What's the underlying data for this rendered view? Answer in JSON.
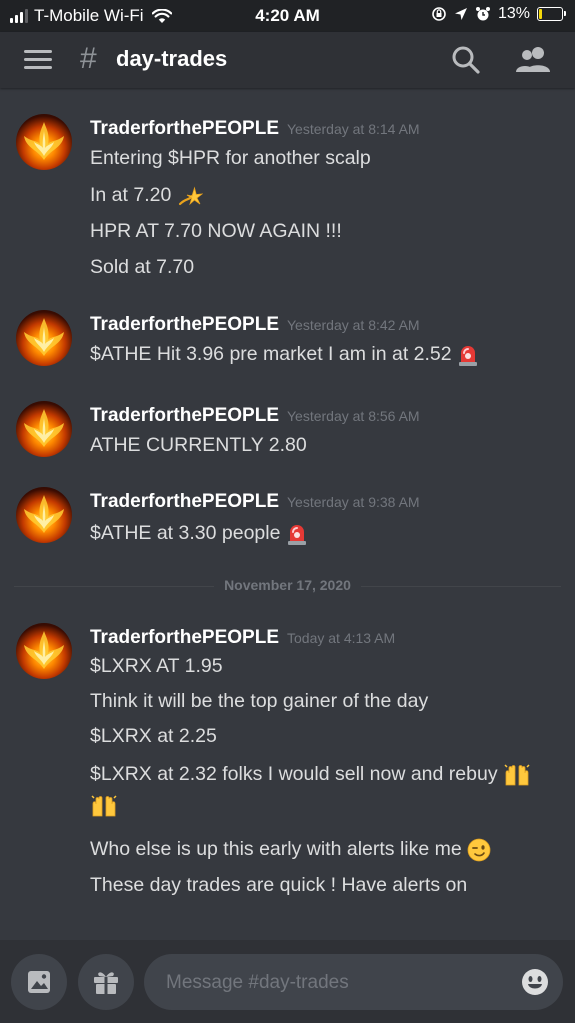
{
  "status_bar": {
    "carrier": "T-Mobile Wi-Fi",
    "time": "4:20 AM",
    "battery": "13%",
    "battery_level": 0.13
  },
  "header": {
    "hash": "#",
    "channel": "day-trades"
  },
  "messages": [
    {
      "author": "TraderforthePEOPLE",
      "timestamp": "Yesterday at 8:14 AM",
      "lines": [
        "Entering $HPR for another scalp",
        "In at 7.20",
        "HPR AT 7.70 NOW AGAIN !!!",
        "Sold at 7.70"
      ]
    },
    {
      "author": "TraderforthePEOPLE",
      "timestamp": "Yesterday at 8:42 AM",
      "lines": [
        "$ATHE Hit 3.96 pre market I am in at 2.52"
      ]
    },
    {
      "author": "TraderforthePEOPLE",
      "timestamp": "Yesterday at 8:56 AM",
      "lines": [
        "ATHE CURRENTLY 2.80"
      ]
    },
    {
      "author": "TraderforthePEOPLE",
      "timestamp": "Yesterday at 9:38 AM",
      "lines": [
        "$ATHE at 3.30 people"
      ]
    },
    {
      "author": "TraderforthePEOPLE",
      "timestamp": "Today at 4:13 AM",
      "lines": [
        "$LXRX AT 1.95",
        "Think it will be the top gainer of the day",
        "$LXRX at 2.25",
        "$LXRX at 2.32 folks I would sell now and rebuy",
        "Who else is up this early with alerts like me",
        "These day trades are quick ! Have alerts on"
      ]
    }
  ],
  "date_divider": "November 17, 2020",
  "composer": {
    "placeholder": "Message #day-trades"
  },
  "icons": {
    "menu": "hamburger-icon",
    "search": "search-icon",
    "members": "members-icon",
    "image": "image-icon",
    "gift": "gift-icon",
    "emoji": "emoji-icon",
    "dizzy": "dizzy-emoji",
    "siren": "siren-emoji",
    "raised_hands": "raised-hands-emoji",
    "wink": "wink-emoji"
  }
}
